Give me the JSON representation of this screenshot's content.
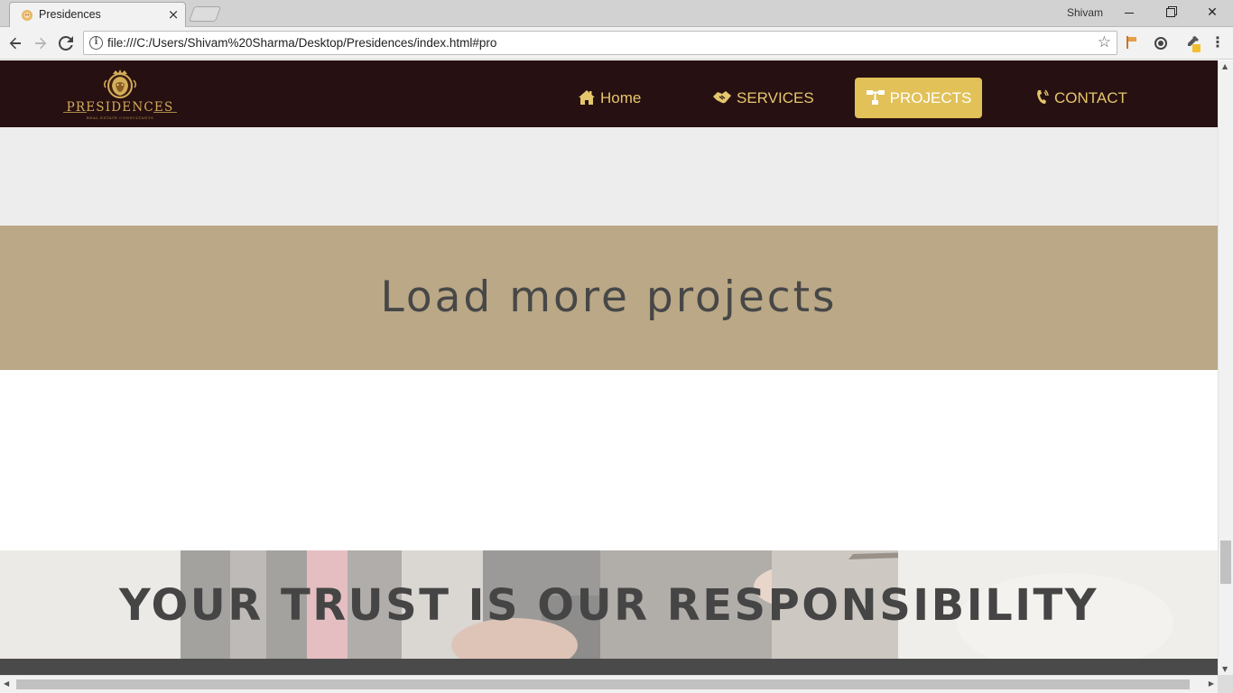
{
  "browser": {
    "tab_title": "Presidences",
    "tab_close": "×",
    "profile_name": "Shivam",
    "url": "file:///C:/Users/Shivam%20Sharma/Desktop/Presidences/index.html#pro",
    "icons": {
      "back": "arrow-left-icon",
      "forward": "arrow-right-icon",
      "reload": "reload-icon",
      "info": "info-icon",
      "bookmark": "star-icon",
      "menu": "kebab-menu-icon"
    }
  },
  "site": {
    "brand": {
      "name": "PRESIDENCES",
      "tagline": "REAL ESTATE CONSULTANTS",
      "color": "#d4ad5a"
    },
    "nav": {
      "background": "#271011",
      "accent": "#e1c158",
      "items": [
        {
          "label": "Home",
          "icon": "home-icon",
          "active": false
        },
        {
          "label": "SERVICES",
          "icon": "handshake-icon",
          "active": false
        },
        {
          "label": "PROJECTS",
          "icon": "sitemap-icon",
          "active": true
        },
        {
          "label": "CONTACT",
          "icon": "phone-icon",
          "active": false
        }
      ]
    },
    "load_more": {
      "text": "Load more projects",
      "background": "#baa886"
    },
    "trust": {
      "heading": "YOUR TRUST IS OUR RESPONSIBILITY"
    }
  }
}
